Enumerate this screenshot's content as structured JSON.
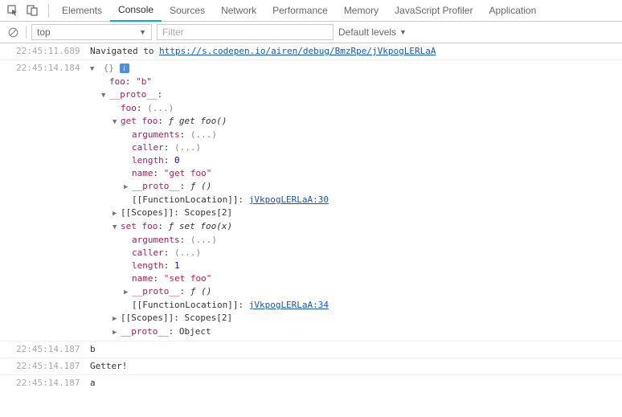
{
  "tabs": {
    "elements": "Elements",
    "console": "Console",
    "sources": "Sources",
    "network": "Network",
    "performance": "Performance",
    "memory": "Memory",
    "profiler": "JavaScript Profiler",
    "application": "Application"
  },
  "toolbar": {
    "context": "top",
    "filter_placeholder": "Filter",
    "levels": "Default levels"
  },
  "log0": {
    "ts": "22:45:11.689",
    "prefix": "Navigated to ",
    "url": "https://s.codepen.io/airen/debug/BmzRpe/jVkpogLERLaA"
  },
  "log1": {
    "ts": "22:45:14.184",
    "root": "{}",
    "foo_k": "foo",
    "foo_v": "\"b\"",
    "proto_k": "__proto__",
    "proto_foo_k": "foo",
    "proto_foo_v": "(...)",
    "get": {
      "k": "get foo",
      "f": "ƒ ",
      "sig": "get foo()",
      "args_k": "arguments",
      "args_v": "(...)",
      "caller_k": "caller",
      "caller_v": "(...)",
      "len_k": "length",
      "len_v": "0",
      "name_k": "name",
      "name_v": "\"get foo\"",
      "proto_k": "__proto__",
      "proto_v": "ƒ ()",
      "floc_k": "[[FunctionLocation]]",
      "floc_v": "jVkpogLERLaA:30",
      "scopes_k": "[[Scopes]]",
      "scopes_v": "Scopes[2]"
    },
    "set": {
      "k": "set foo",
      "f": "ƒ ",
      "sig": "set foo(x)",
      "args_k": "arguments",
      "args_v": "(...)",
      "caller_k": "caller",
      "caller_v": "(...)",
      "len_k": "length",
      "len_v": "1",
      "name_k": "name",
      "name_v": "\"set foo\"",
      "proto_k": "__proto__",
      "proto_v": "ƒ ()",
      "floc_k": "[[FunctionLocation]]",
      "floc_v": "jVkpogLERLaA:34",
      "scopes_k": "[[Scopes]]",
      "scopes_v": "Scopes[2]"
    },
    "obj_proto_k": "__proto__",
    "obj_proto_v": "Object"
  },
  "log2": {
    "ts": "22:45:14.187",
    "msg": "b"
  },
  "log3": {
    "ts": "22:45:14.187",
    "msg": "Getter!"
  },
  "log4": {
    "ts": "22:45:14.187",
    "msg": "a"
  }
}
